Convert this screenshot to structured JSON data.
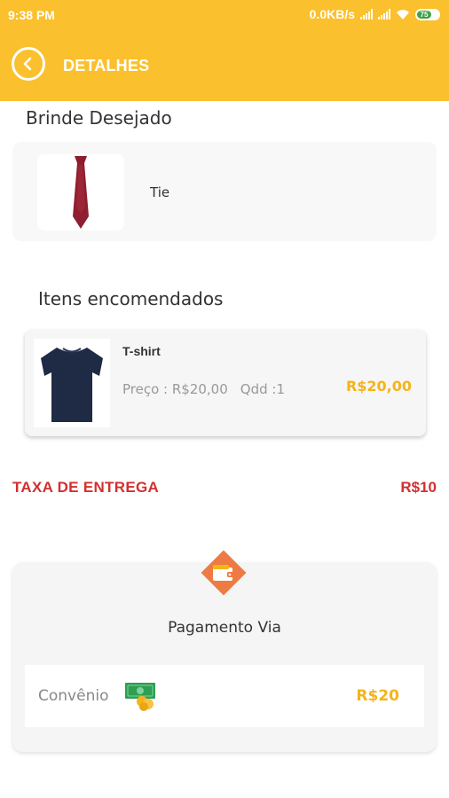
{
  "status_bar": {
    "time": "9:38 PM",
    "network_speed": "0.0KB/s",
    "battery_level": "75",
    "icons": [
      "signal-icon",
      "signal-icon",
      "wifi-icon",
      "battery-icon"
    ]
  },
  "header": {
    "title": "DETALHES",
    "back_icon": "chevron-left-circle-icon",
    "background_color": "#FBC02D"
  },
  "gift": {
    "section_title": "Brinde Desejado",
    "item_name": "Tie",
    "image_icon": "necktie-image"
  },
  "order": {
    "section_title": "Itens encomendados",
    "items": [
      {
        "name": "T-shirt",
        "price_text": "Preço : R$20,00",
        "qty_text": "Qdd :1",
        "total": "R$20,00",
        "image_icon": "tshirt-image"
      }
    ]
  },
  "delivery": {
    "label": "TAXA DE ENTREGA",
    "value": "R$10",
    "color": "#D32F2F"
  },
  "payment": {
    "title": "Pagamento Via",
    "method": "Convênio",
    "amount": "R$20",
    "wallet_icon": "wallet-icon",
    "method_icon": "cash-coins-icon",
    "accent_color": "#F4B41A",
    "badge_color": "#EE7B43"
  }
}
